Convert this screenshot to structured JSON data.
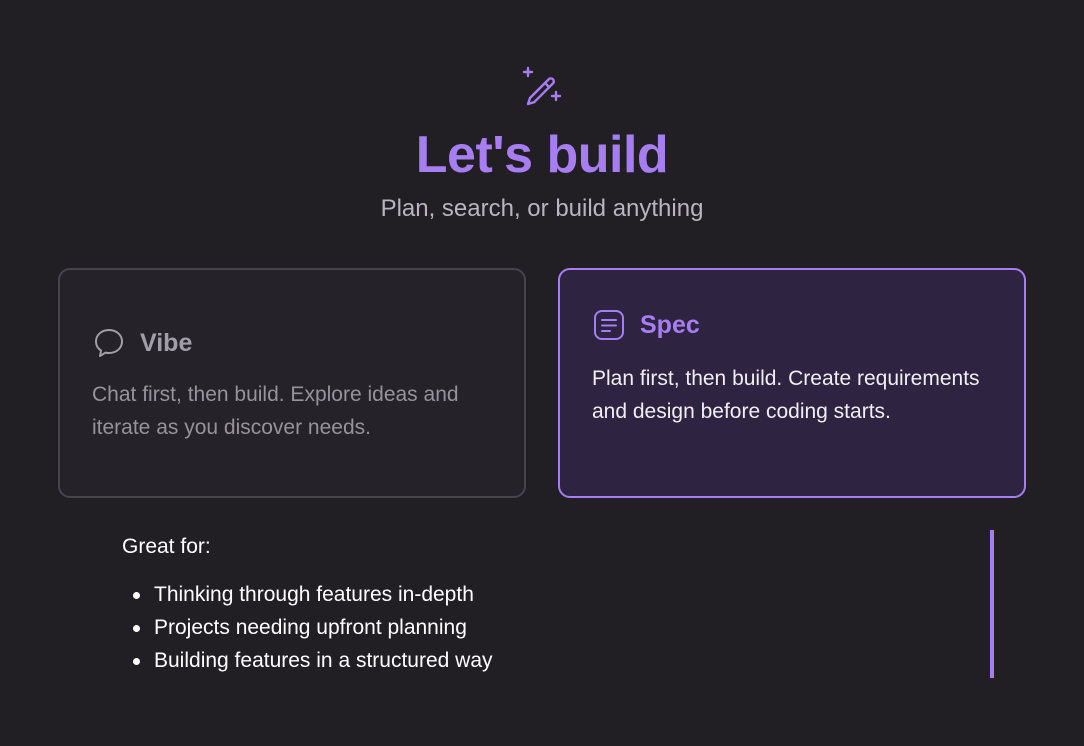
{
  "hero": {
    "icon": "magic-wand-sparkle-icon",
    "title": "Let's build",
    "subtitle": "Plan, search, or build anything"
  },
  "modes": {
    "vibe": {
      "icon": "chat-bubble-icon",
      "title": "Vibe",
      "description": "Chat first, then build. Explore ideas and iterate as you discover needs.",
      "selected": false
    },
    "spec": {
      "icon": "document-lines-icon",
      "title": "Spec",
      "description": "Plan first, then build. Create requirements and design before coding starts.",
      "selected": true
    }
  },
  "details": {
    "heading": "Great for:",
    "items": [
      "Thinking through features in-depth",
      "Projects needing upfront planning",
      "Building features in a structured way"
    ]
  },
  "colors": {
    "background": "#211e24",
    "accent": "#a77ef2",
    "selected_card_bg": "#2e2340",
    "card_bg": "#252229",
    "card_border": "#47434c"
  }
}
